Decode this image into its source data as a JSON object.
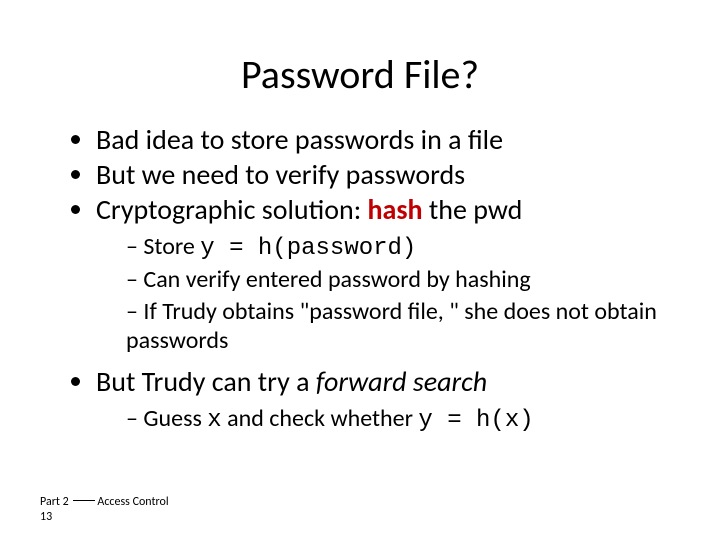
{
  "title": "Password File?",
  "bullets": {
    "b1": "Bad idea to store passwords in a file",
    "b2": "But we need to verify passwords",
    "b3_pre": "Cryptographic solution: ",
    "b3_hash": "hash",
    "b3_post": " the pwd",
    "b3_sub": {
      "s1_text": "Store ",
      "s1_code": "y = h(password)",
      "s2": "Can verify entered password by hashing",
      "s3": "If Trudy obtains \"password file, \" she does not obtain passwords"
    },
    "b4_pre": "But Trudy can try a ",
    "b4_ital": "forward search",
    "b4_sub": {
      "s1_a": "Guess ",
      "s1_x": "x",
      "s1_b": " and check whether ",
      "s1_eq": "y = h(x)"
    }
  },
  "footer": {
    "part": "Part 2 ",
    "section": "Access Control",
    "page": "13"
  }
}
